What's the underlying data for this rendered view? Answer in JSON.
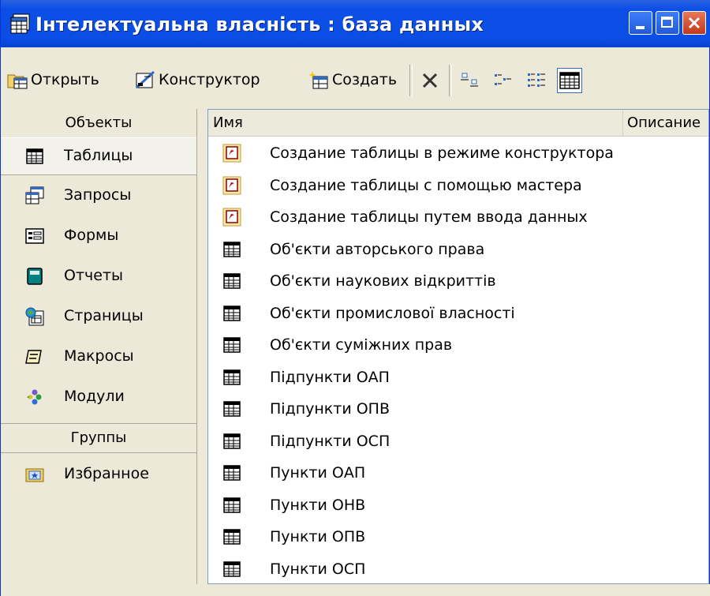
{
  "window": {
    "title": "Інтелектуальна власність : база данных"
  },
  "toolbar": {
    "open": "Открыть",
    "design": "Конструктор",
    "create": "Создать"
  },
  "objects_header": "Объекты",
  "objects": [
    {
      "label": "Таблицы",
      "icon": "table-icon"
    },
    {
      "label": "Запросы",
      "icon": "query-icon"
    },
    {
      "label": "Формы",
      "icon": "form-icon"
    },
    {
      "label": "Отчеты",
      "icon": "report-icon"
    },
    {
      "label": "Страницы",
      "icon": "page-icon"
    },
    {
      "label": "Макросы",
      "icon": "macro-icon"
    },
    {
      "label": "Модули",
      "icon": "module-icon"
    }
  ],
  "groups_header": "Группы",
  "groups": [
    {
      "label": "Избранное",
      "icon": "favorites-icon"
    }
  ],
  "list": {
    "col_name": "Имя",
    "col_desc": "Описание",
    "items": [
      {
        "label": "Создание таблицы в режиме конструктора",
        "icon": "shortcut-icon"
      },
      {
        "label": "Создание таблицы с помощью мастера",
        "icon": "shortcut-icon"
      },
      {
        "label": "Создание таблицы путем ввода данных",
        "icon": "shortcut-icon"
      },
      {
        "label": "Об'єкти авторського права",
        "icon": "table-icon"
      },
      {
        "label": "Об'єкти наукових відкриттів",
        "icon": "table-icon"
      },
      {
        "label": "Об'єкти промислової власності",
        "icon": "table-icon"
      },
      {
        "label": "Об'єкти суміжних прав",
        "icon": "table-icon"
      },
      {
        "label": "Підпункти ОАП",
        "icon": "table-icon"
      },
      {
        "label": "Підпункти ОПВ",
        "icon": "table-icon"
      },
      {
        "label": "Підпункти ОСП",
        "icon": "table-icon"
      },
      {
        "label": "Пункти ОАП",
        "icon": "table-icon"
      },
      {
        "label": "Пункти ОНВ",
        "icon": "table-icon"
      },
      {
        "label": "Пункти ОПВ",
        "icon": "table-icon"
      },
      {
        "label": "Пункти ОСП",
        "icon": "table-icon"
      }
    ]
  }
}
